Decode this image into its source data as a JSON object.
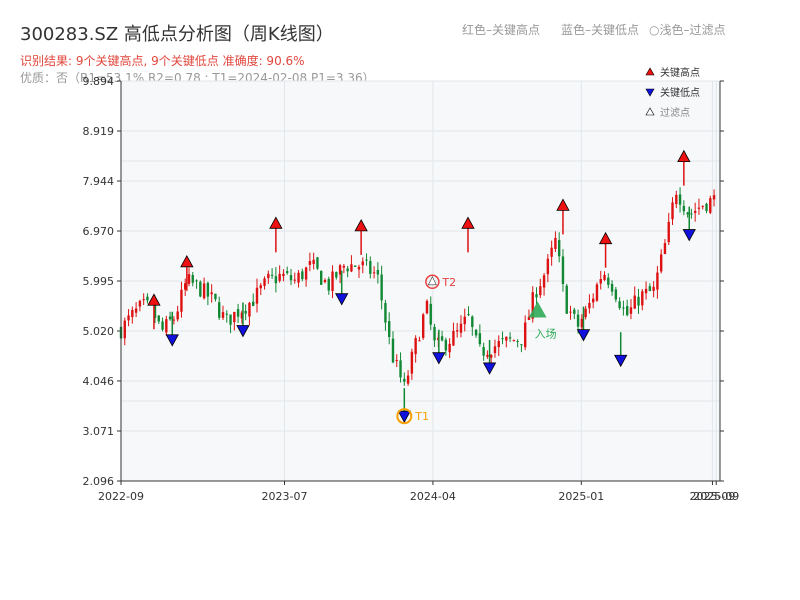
{
  "header": {
    "title": "300283.SZ 高低点分析图（周K线图）",
    "hint_red": "红色–关键高点",
    "hint_blue": "蓝色–关键低点",
    "hint_light": "○浅色–过滤点",
    "result_line": "识别结果: 9个关键高点, 9个关键低点  准确度: 90.6%",
    "quality_line": "优质：否（R1=53.1%  R2=0.78 ; T1=2024-02-08 P1=3.36）"
  },
  "colors": {
    "up": "#dd1111",
    "down": "#118833",
    "high_marker": "#ee1111",
    "low_marker": "#1111dd",
    "grid": "#e2e6ea",
    "plot_bg": "#f6f8fa",
    "t1": "#f5a000",
    "t2": "#e84040",
    "special": "#2eaa55"
  },
  "chart_data": {
    "type": "candlestick",
    "xlabel": "",
    "ylabel": "",
    "ylim": [
      2.096,
      9.894
    ],
    "y_ticks": [
      "9.894",
      "8.919",
      "7.944",
      "6.970",
      "5.995",
      "5.020",
      "4.046",
      "3.071",
      "2.096"
    ],
    "x_range": [
      "2022-09-01",
      "2025-09-15"
    ],
    "x_ticks": [
      {
        "date": "2022-09-01",
        "label": "2022-09"
      },
      {
        "date": "2023-07-01",
        "label": "2023-07"
      },
      {
        "date": "2024-04-01",
        "label": "2024-04"
      },
      {
        "date": "2025-01-01",
        "label": "2025-01"
      },
      {
        "date": "2025-09-01",
        "label": "2025-09"
      },
      {
        "date": "2025-09-08",
        "label": "2025-09"
      }
    ],
    "legend": {
      "placement": "top-right",
      "items": [
        {
          "label": "关键高点",
          "symbol": "up-triangle",
          "color": "#ee1111"
        },
        {
          "label": "关键低点",
          "symbol": "down-triangle",
          "color": "#1111dd"
        },
        {
          "label": "过滤点",
          "symbol": "up-triangle-outline",
          "color": "#888888"
        }
      ]
    },
    "price_path": [
      [
        "2022-09-01",
        5.05
      ],
      [
        "2022-09-20",
        5.3
      ],
      [
        "2022-10-10",
        5.5
      ],
      [
        "2022-10-28",
        5.45
      ],
      [
        "2022-11-15",
        5.0
      ],
      [
        "2022-12-10",
        5.3
      ],
      [
        "2023-01-01",
        6.0
      ],
      [
        "2023-01-25",
        5.85
      ],
      [
        "2023-02-20",
        5.6
      ],
      [
        "2023-03-15",
        5.2
      ],
      [
        "2023-04-05",
        5.4
      ],
      [
        "2023-05-01",
        5.6
      ],
      [
        "2023-06-01",
        6.0
      ],
      [
        "2023-06-25",
        6.1
      ],
      [
        "2023-07-20",
        6.0
      ],
      [
        "2023-08-20",
        6.3
      ],
      [
        "2023-09-20",
        5.9
      ],
      [
        "2023-10-20",
        6.3
      ],
      [
        "2023-11-20",
        6.3
      ],
      [
        "2023-12-20",
        6.1
      ],
      [
        "2024-01-15",
        4.6
      ],
      [
        "2024-02-08",
        3.9
      ],
      [
        "2024-02-25",
        4.6
      ],
      [
        "2024-03-20",
        5.5
      ],
      [
        "2024-04-05",
        4.7
      ],
      [
        "2024-04-25",
        4.8
      ],
      [
        "2024-05-20",
        5.0
      ],
      [
        "2024-06-05",
        5.3
      ],
      [
        "2024-06-25",
        4.6
      ],
      [
        "2024-07-15",
        4.7
      ],
      [
        "2024-08-15",
        4.8
      ],
      [
        "2024-09-15",
        4.9
      ],
      [
        "2024-10-08",
        5.8
      ],
      [
        "2024-10-28",
        6.2
      ],
      [
        "2024-11-15",
        6.8
      ],
      [
        "2024-12-01",
        5.6
      ],
      [
        "2024-12-25",
        5.1
      ],
      [
        "2025-01-15",
        5.5
      ],
      [
        "2025-02-10",
        6.2
      ],
      [
        "2025-03-01",
        5.9
      ],
      [
        "2025-03-25",
        5.3
      ],
      [
        "2025-04-20",
        5.7
      ],
      [
        "2025-05-15",
        5.8
      ],
      [
        "2025-06-10",
        6.9
      ],
      [
        "2025-06-25",
        7.8
      ],
      [
        "2025-07-20",
        7.3
      ],
      [
        "2025-08-15",
        7.5
      ],
      [
        "2025-09-10",
        7.6
      ]
    ],
    "key_highs": [
      {
        "date": "2022-11-01",
        "value": 5.6
      },
      {
        "date": "2023-01-01",
        "value": 6.35
      },
      {
        "date": "2023-06-15",
        "value": 7.1
      },
      {
        "date": "2023-11-20",
        "value": 7.05
      },
      {
        "date": "2024-06-05",
        "value": 7.1
      },
      {
        "date": "2024-11-28",
        "value": 7.45
      },
      {
        "date": "2025-02-15",
        "value": 6.8
      },
      {
        "date": "2025-07-10",
        "value": 8.4
      }
    ],
    "key_lows": [
      {
        "date": "2022-12-05",
        "value": 4.85
      },
      {
        "date": "2023-04-15",
        "value": 5.03
      },
      {
        "date": "2023-10-15",
        "value": 5.65
      },
      {
        "date": "2024-02-08",
        "value": 3.36
      },
      {
        "date": "2024-04-12",
        "value": 4.5
      },
      {
        "date": "2024-07-15",
        "value": 4.3
      },
      {
        "date": "2025-01-05",
        "value": 4.95
      },
      {
        "date": "2025-03-15",
        "value": 4.45
      },
      {
        "date": "2025-07-20",
        "value": 6.9
      }
    ],
    "annotations": [
      {
        "date": "2024-02-08",
        "value": 3.36,
        "label": "T1",
        "kind": "t1"
      },
      {
        "date": "2024-03-31",
        "value": 5.98,
        "label": "T2",
        "kind": "t2"
      },
      {
        "date": "2024-10-12",
        "value": 5.4,
        "label": "入场",
        "kind": "special"
      }
    ]
  }
}
